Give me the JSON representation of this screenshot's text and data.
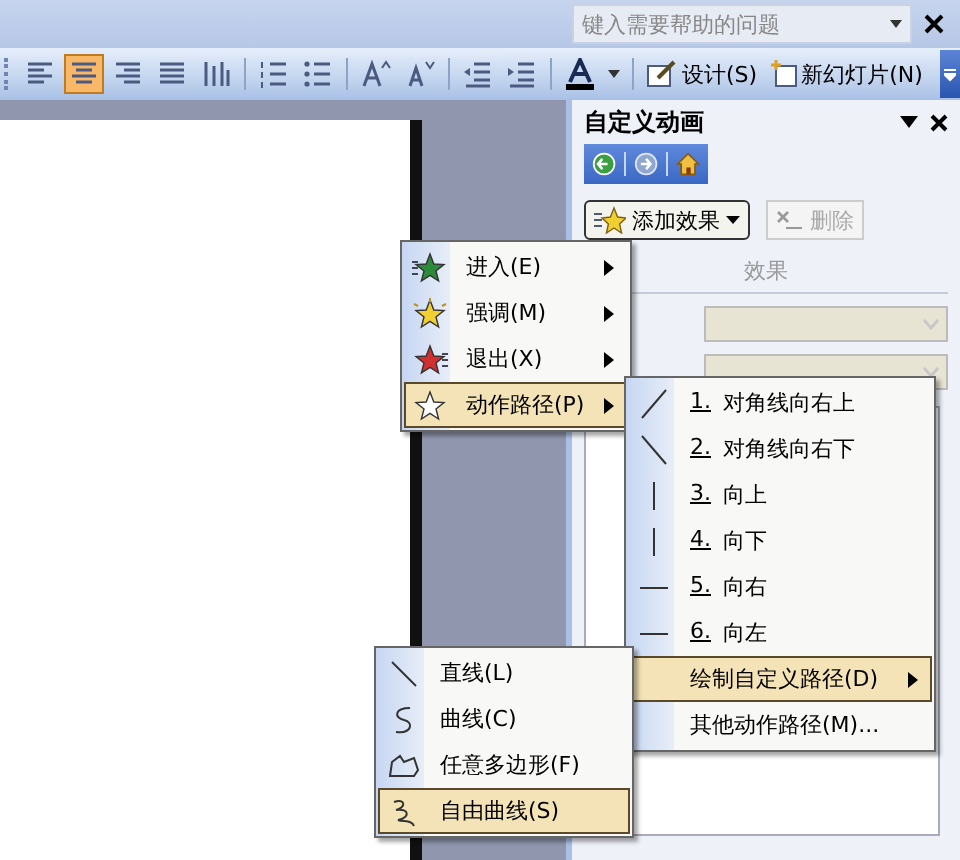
{
  "help_box": {
    "placeholder": "键入需要帮助的问题"
  },
  "toolbar": [
    {
      "kind": "align-left",
      "selected": false
    },
    {
      "kind": "align-center",
      "selected": true
    },
    {
      "kind": "align-right",
      "selected": false
    },
    {
      "kind": "justify",
      "selected": false
    },
    {
      "kind": "distribute",
      "selected": false
    },
    {
      "kind": "separator"
    },
    {
      "kind": "numbering",
      "selected": false
    },
    {
      "kind": "bullets",
      "selected": false
    },
    {
      "kind": "separator"
    },
    {
      "kind": "grow-font",
      "selected": false
    },
    {
      "kind": "shrink-font",
      "selected": false
    },
    {
      "kind": "separator"
    },
    {
      "kind": "outdent",
      "selected": false
    },
    {
      "kind": "indent",
      "selected": false
    },
    {
      "kind": "separator"
    },
    {
      "kind": "font-color",
      "selected": false
    },
    {
      "kind": "separator"
    },
    {
      "kind": "design",
      "label": "设计(S)"
    },
    {
      "kind": "new-slide",
      "label": "新幻灯片(N)"
    }
  ],
  "task_pane": {
    "title": "自定义动画",
    "add_effect": "添加效果",
    "remove": {
      "label": "删除",
      "disabled": true
    },
    "section_label": "效果",
    "dropdowns": [
      {
        "disabled": true
      },
      {
        "disabled": true
      }
    ]
  },
  "effect_menu": [
    {
      "kind": "enter",
      "label": "进入(E)",
      "selected": false
    },
    {
      "kind": "emphasis",
      "label": "强调(M)",
      "selected": false
    },
    {
      "kind": "exit",
      "label": "退出(X)",
      "selected": false
    },
    {
      "kind": "path",
      "label": "动作路径(P)",
      "selected": true
    }
  ],
  "path_menu": [
    {
      "kind": "diag-up",
      "number": "1.",
      "label": "对角线向右上",
      "selected": false
    },
    {
      "kind": "diag-down",
      "number": "2.",
      "label": "对角线向右下",
      "selected": false
    },
    {
      "kind": "vertical",
      "number": "3.",
      "label": "向上",
      "selected": false
    },
    {
      "kind": "vertical",
      "number": "4.",
      "label": "向下",
      "selected": false
    },
    {
      "kind": "horizontal",
      "number": "5.",
      "label": "向右",
      "selected": false
    },
    {
      "kind": "horizontal",
      "number": "6.",
      "label": "向左",
      "selected": false
    },
    {
      "kind": "submenu",
      "label": "绘制自定义路径(D)",
      "selected": true
    },
    {
      "kind": "plain",
      "label": "其他动作路径(M)...",
      "selected": false
    }
  ],
  "custom_path_menu": [
    {
      "kind": "line",
      "label": "直线(L)",
      "selected": false
    },
    {
      "kind": "curve",
      "label": "曲线(C)",
      "selected": false
    },
    {
      "kind": "polygon",
      "label": "任意多边形(F)",
      "selected": false
    },
    {
      "kind": "scribble",
      "label": "自由曲线(S)",
      "selected": true
    }
  ]
}
